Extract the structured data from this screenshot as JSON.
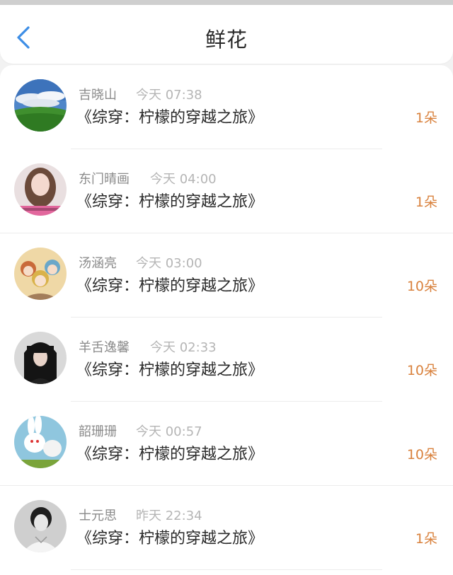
{
  "header": {
    "title": "鲜花",
    "back_icon": "chevron-left-icon",
    "accent_color": "#3d8ee6"
  },
  "gifts": [
    {
      "name": "吉晓山",
      "time": "今天 07:38",
      "book": "《综穿：柠檬的穿越之旅》",
      "count": "1朵",
      "avatar": "landscape-avatar"
    },
    {
      "name": "东门晴画",
      "time": "今天 04:00",
      "book": "《综穿：柠檬的穿越之旅》",
      "count": "1朵",
      "avatar": "girl-avatar"
    },
    {
      "name": "汤涵亮",
      "time": "今天 03:00",
      "book": "《综穿：柠檬的穿越之旅》",
      "count": "10朵",
      "avatar": "group-avatar"
    },
    {
      "name": "羊舌逸馨",
      "time": "今天 02:33",
      "book": "《综穿：柠檬的穿越之旅》",
      "count": "10朵",
      "avatar": "woman-avatar"
    },
    {
      "name": "韶珊珊",
      "time": "今天 00:57",
      "book": "《综穿：柠檬的穿越之旅》",
      "count": "10朵",
      "avatar": "rabbid-avatar"
    },
    {
      "name": "士元思",
      "time": "昨天 22:34",
      "book": "《综穿：柠檬的穿越之旅》",
      "count": "1朵",
      "avatar": "man-avatar"
    }
  ],
  "colors": {
    "count": "#d9823e",
    "name": "#8a8a8a",
    "time": "#b5b5b5",
    "book": "#2a2a2a"
  }
}
